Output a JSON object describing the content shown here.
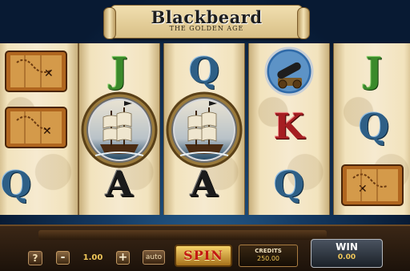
{
  "game": {
    "title": "Blackbeard",
    "subtitle": "THE GOLDEN AGE"
  },
  "reels": [
    {
      "symbols": [
        "treasure-map",
        "treasure-map",
        "Q"
      ]
    },
    {
      "symbols": [
        "J",
        "pirate-ship",
        "A"
      ]
    },
    {
      "symbols": [
        "Q",
        "pirate-ship",
        "A"
      ]
    },
    {
      "symbols": [
        "cannon",
        "K",
        "Q"
      ]
    },
    {
      "symbols": [
        "J",
        "Q",
        "treasure-map"
      ]
    }
  ],
  "controls": {
    "help_label": "?",
    "minus_label": "-",
    "bet_value": "1.00",
    "plus_label": "+",
    "auto_label": "auto",
    "spin_label": "SPIN",
    "credits_label": "CREDITS",
    "credits_value": "250.00",
    "win_label": "WIN",
    "win_value": "0.00"
  },
  "colors": {
    "background": "#0d2340",
    "reel_parchment": "#f6ead0",
    "spin_text": "#c31a12",
    "value_gold": "#f1c85a"
  }
}
